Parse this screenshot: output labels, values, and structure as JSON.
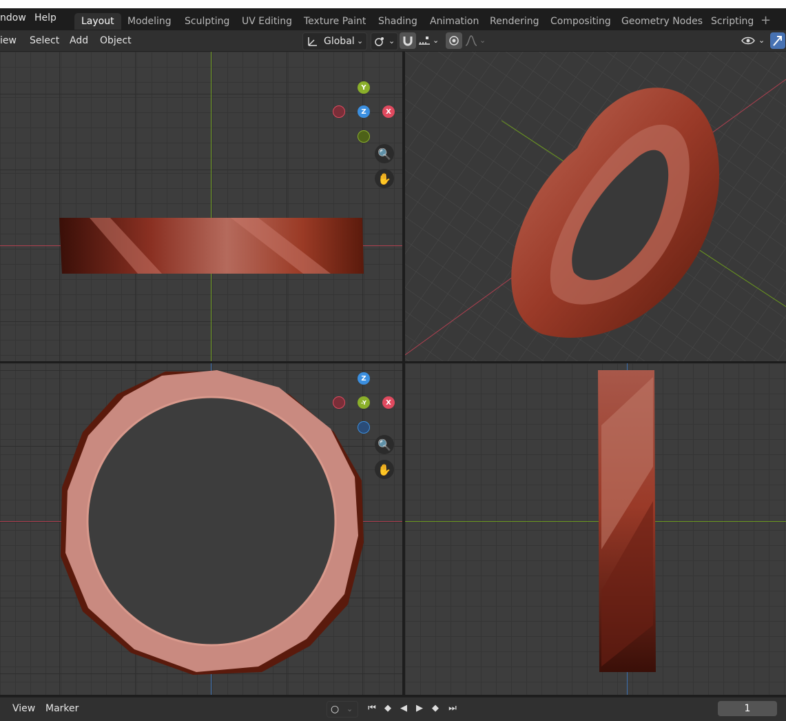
{
  "menu": {
    "window": "ndow",
    "help": "Help"
  },
  "workspaces": [
    "Layout",
    "Modeling",
    "Sculpting",
    "UV Editing",
    "Texture Paint",
    "Shading",
    "Animation",
    "Rendering",
    "Compositing",
    "Geometry Nodes",
    "Scripting"
  ],
  "active_workspace": "Layout",
  "header": {
    "view": "iew",
    "select": "Select",
    "add": "Add",
    "object": "Object",
    "orientation": "Global"
  },
  "gizmo_top": {
    "y": "Y",
    "z": "Z",
    "x": "X"
  },
  "gizmo_front": {
    "z": "Z",
    "y": "-Y",
    "x": "X"
  },
  "timeline": {
    "view": "View",
    "marker": "Marker",
    "current_frame": "1"
  },
  "colors": {
    "accent": "#4772b3",
    "x_axis": "#e04a5f",
    "y_axis": "#8bb02a",
    "z_axis": "#3b8fe0",
    "ring": "#b8503f"
  }
}
